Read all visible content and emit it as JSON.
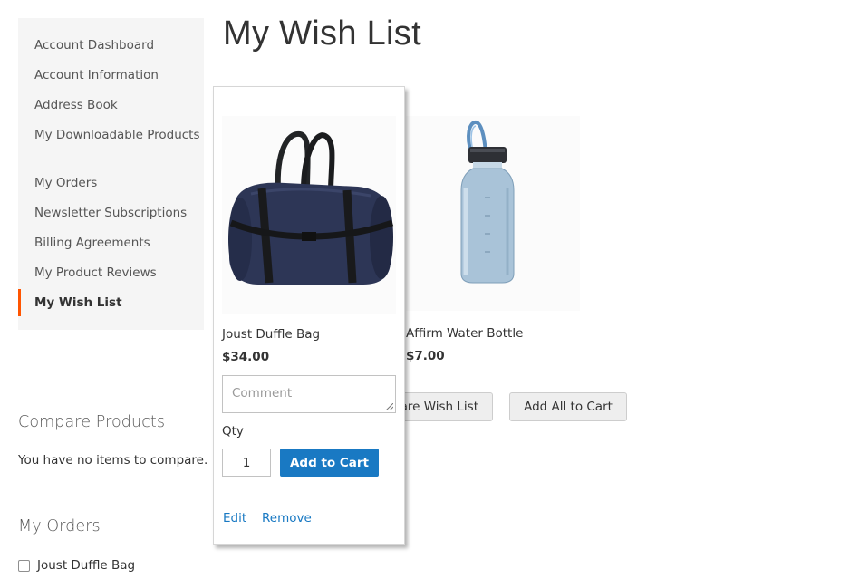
{
  "sidebar": {
    "items": [
      {
        "label": "Account Dashboard"
      },
      {
        "label": "Account Information"
      },
      {
        "label": "Address Book"
      },
      {
        "label": "My Downloadable Products"
      },
      {
        "label": "My Orders"
      },
      {
        "label": "Newsletter Subscriptions"
      },
      {
        "label": "Billing Agreements"
      },
      {
        "label": "My Product Reviews"
      },
      {
        "label": "My Wish List",
        "active": true
      }
    ]
  },
  "compare": {
    "title": "Compare Products",
    "empty_text": "You have no items to compare."
  },
  "orders_block": {
    "title": "My Orders",
    "items": [
      {
        "label": "Joust Duffle Bag",
        "checked": false
      }
    ]
  },
  "page": {
    "title": "My Wish List"
  },
  "wishlist": {
    "items": [
      {
        "name": "Joust Duffle Bag",
        "price": "$34.00",
        "comment_placeholder": "Comment",
        "qty_label": "Qty",
        "qty": "1",
        "add_to_cart": "Add to Cart",
        "edit": "Edit",
        "remove": "Remove",
        "icon": "duffle-bag-image"
      },
      {
        "name": "Affirm Water Bottle",
        "price": "$7.00",
        "icon": "water-bottle-image"
      }
    ],
    "share_button": "are Wish List",
    "add_all_button": "Add All to Cart"
  },
  "colors": {
    "accent": "#ff5501",
    "link": "#1979c3",
    "primary_button": "#1979c3"
  }
}
